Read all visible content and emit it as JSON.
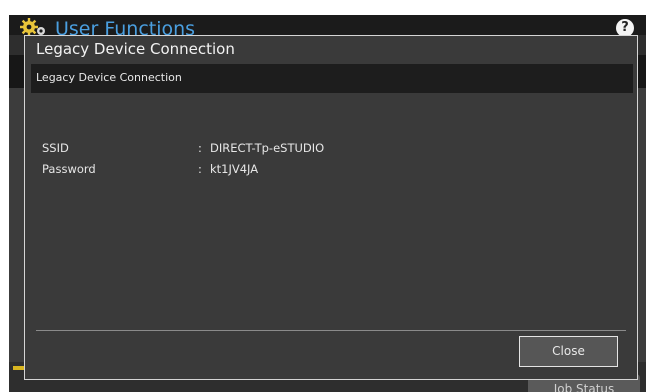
{
  "app": {
    "title": "User Functions",
    "help_label": "?",
    "job_status_label": "Job Status"
  },
  "dialog": {
    "title": "Legacy Device Connection",
    "subtitle": "Legacy Device Connection",
    "rows": [
      {
        "label": "SSID",
        "separator": ":",
        "value": "DIRECT-Tp-eSTUDIO"
      },
      {
        "label": "Password",
        "separator": ":",
        "value": "kt1JV4JA"
      }
    ],
    "close_label": "Close"
  },
  "icons": {
    "app_icon": "gear-icon",
    "help_icon": "help-icon"
  },
  "colors": {
    "title_blue": "#4a9fe0",
    "dialog_bg": "#3a3a3a",
    "accent_yellow": "#d8b520"
  }
}
